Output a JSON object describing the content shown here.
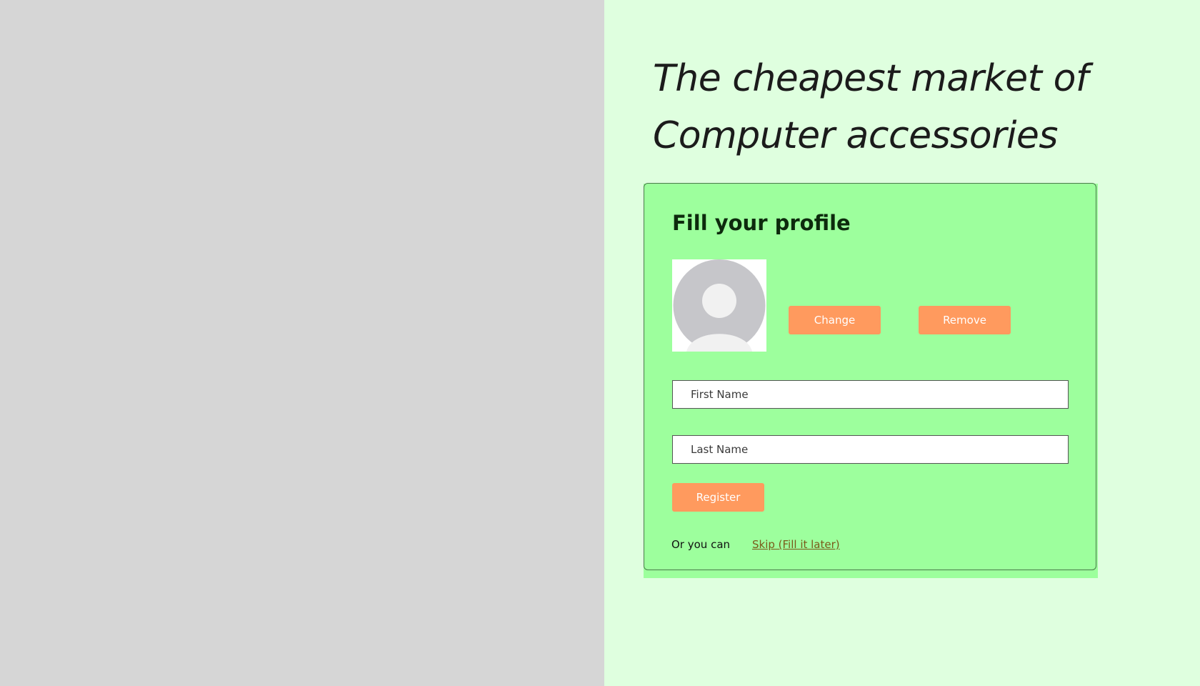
{
  "hero": {
    "headline_line1": "The cheapest market of",
    "headline_line2": "Computer accessories"
  },
  "profile_form": {
    "title": "Fill your profile",
    "avatar_icon": "default-user-avatar-icon",
    "change_label": "Change",
    "remove_label": "Remove",
    "first_name_placeholder": "First Name",
    "last_name_placeholder": "Last Name",
    "register_label": "Register",
    "alt_text": "Or you can",
    "skip_label": "Skip (Fill it later)"
  },
  "colors": {
    "left_background": "#d6d6d6",
    "right_background": "#dfffdf",
    "card_background": "#9dff9d",
    "button": "#ff9a5e",
    "link": "#7a5a1a"
  }
}
